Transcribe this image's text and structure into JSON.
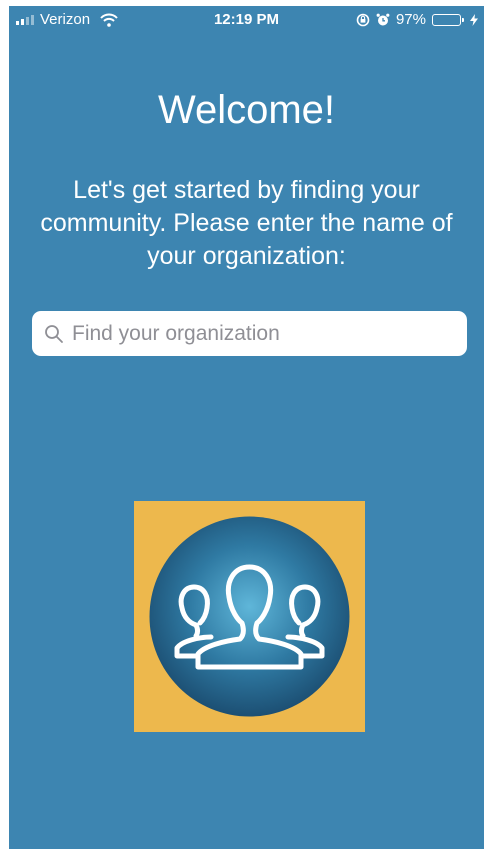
{
  "status_bar": {
    "carrier": "Verizon",
    "time": "12:19 PM",
    "battery_percent": "97%",
    "battery_level": 0.97,
    "battery_color": "#f4c51f",
    "icons": [
      "signal-icon",
      "wifi-icon",
      "orientation-lock-icon",
      "alarm-icon",
      "battery-icon",
      "charging-icon"
    ]
  },
  "welcome": {
    "title": "Welcome!",
    "message": "Let's get started by finding your community.  Please enter the name of your organization:"
  },
  "search": {
    "icon": "search-icon",
    "placeholder": "Find your organization",
    "value": ""
  },
  "logo": {
    "icon": "community-icon",
    "background": "#edb84d"
  },
  "colors": {
    "screen_background": "#3d85b1",
    "text": "#ffffff"
  }
}
